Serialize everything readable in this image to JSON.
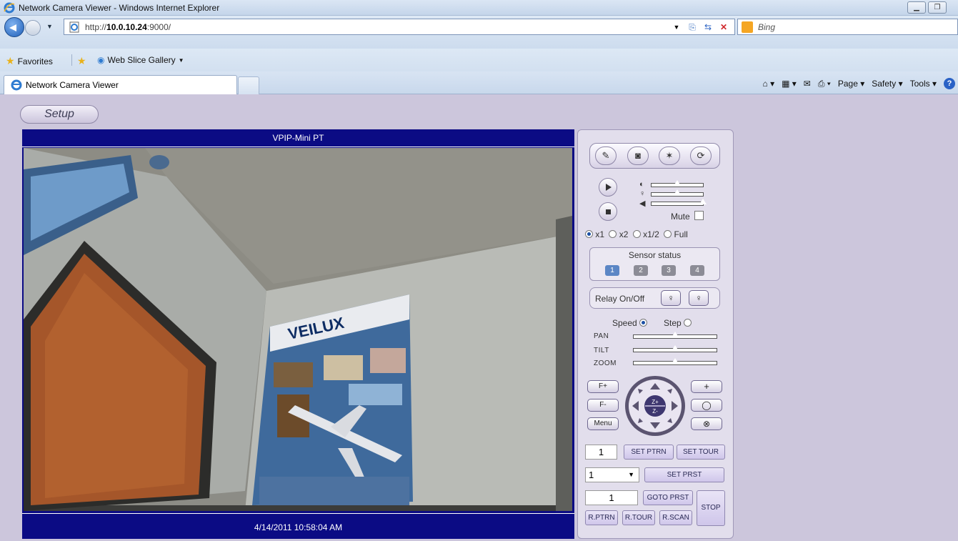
{
  "window": {
    "title": "Network Camera Viewer - Windows Internet Explorer"
  },
  "address_bar": {
    "url_prefix": "http://",
    "url_host": "10.0.10.24",
    "url_suffix": ":9000/",
    "search_placeholder": "Bing"
  },
  "favorites_bar": {
    "favorites_label": "Favorites",
    "web_slice_label": "Web Slice Gallery"
  },
  "tabs": [
    {
      "label": "Network Camera Viewer"
    }
  ],
  "command_bar": {
    "page": "Page",
    "safety": "Safety",
    "tools": "Tools"
  },
  "page": {
    "setup_label": "Setup",
    "viewer_title": "VPIP-Mini PT",
    "timestamp": "4/14/2011 10:58:04 AM",
    "poster_brand": "VEILUX"
  },
  "controls": {
    "mute_label": "Mute",
    "zoom_options": [
      "x1",
      "x2",
      "x1/2",
      "Full"
    ],
    "zoom_selected": "x1",
    "sensor_title": "Sensor status",
    "sensors": [
      "1",
      "2",
      "3",
      "4"
    ],
    "relay_label": "Relay On/Off",
    "speed_label": "Speed",
    "step_label": "Step",
    "pan_label": "PAN",
    "tilt_label": "TILT",
    "zoom_label": "ZOOM",
    "focus_plus": "F+",
    "focus_minus": "F-",
    "menu_label": "Menu",
    "plus_label": "+",
    "joystick_zoom_in": "Z+",
    "joystick_zoom_out": "Z-",
    "pattern_value": "1",
    "set_ptrn": "SET PTRN",
    "set_tour": "SET TOUR",
    "preset_select": "1",
    "set_prst": "SET PRST",
    "goto_value": "1",
    "goto_prst": "GOTO PRST",
    "stop": "STOP",
    "r_ptrn": "R.PTRN",
    "r_tour": "R.TOUR",
    "r_scan": "R.SCAN"
  },
  "levels": {
    "brightness": 0.5,
    "contrast": 0.5,
    "volume": 1.0,
    "pan": 0.5,
    "tilt": 0.5,
    "zoom": 0.5
  }
}
